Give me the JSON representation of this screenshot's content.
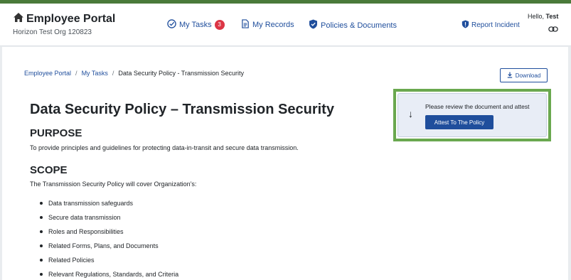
{
  "brand": {
    "title": "Employee Portal",
    "org": "Horizon Test Org 120823",
    "icon": "home-icon"
  },
  "nav": {
    "tasks": {
      "label": "My Tasks",
      "count": "3",
      "icon": "check-circle-icon"
    },
    "records": {
      "label": "My Records",
      "icon": "document-icon"
    },
    "policies": {
      "label": "Policies & Documents",
      "icon": "shield-check-icon"
    }
  },
  "report": {
    "label": "Report Incident",
    "icon": "shield-alert-icon"
  },
  "user": {
    "greeting": "Hello,",
    "name": "Test",
    "icon": "link-icon"
  },
  "breadcrumb": {
    "items": [
      "Employee Portal",
      "My Tasks"
    ],
    "current": "Data Security Policy - Transmission Security",
    "separator": "/"
  },
  "download": {
    "label": "Download",
    "icon": "download-icon"
  },
  "attest": {
    "arrow": "↓",
    "message": "Please review the document and attest",
    "button": "Attest To The Policy"
  },
  "document": {
    "title": "Data Security Policy – Transmission Security",
    "purpose_heading": "PURPOSE",
    "purpose_text": "To provide principles and guidelines for protecting data-in-transit and secure data transmission.",
    "scope_heading": "SCOPE",
    "scope_text": "The Transmission Security Policy will cover Organization’s:",
    "scope_items": [
      "Data transmission safeguards",
      "Secure data transmission",
      "Roles and Responsibilities",
      "Related Forms, Plans, and Documents",
      "Related Policies",
      "Relevant Regulations, Standards, and Criteria"
    ]
  },
  "colors": {
    "accent": "#1f4e9c",
    "badge": "#dc3545",
    "highlight": "#6aa84f",
    "top_bar": "#4a7a3a"
  }
}
